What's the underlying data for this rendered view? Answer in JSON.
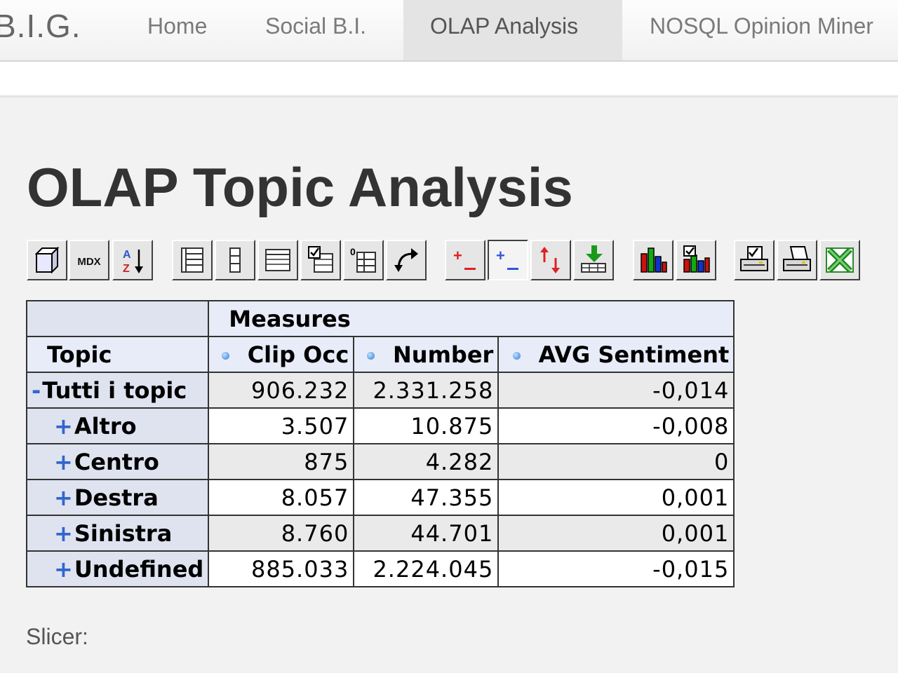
{
  "nav": {
    "brand": "B.I.G.",
    "items": [
      {
        "label": "Home",
        "active": false
      },
      {
        "label": "Social B.I.",
        "active": false
      },
      {
        "label": "OLAP Analysis",
        "active": true
      },
      {
        "label": "NOSQL Opinion Miner",
        "active": false
      }
    ]
  },
  "page": {
    "title": "OLAP Topic Analysis",
    "slicer_label": "Slicer:"
  },
  "toolbar": {
    "buttons": [
      {
        "icon": "cube-navigator-icon"
      },
      {
        "icon": "mdx-editor-icon",
        "text": "MDX"
      },
      {
        "icon": "sort-az-icon"
      },
      {
        "icon": "show-parents-icon"
      },
      {
        "icon": "hide-spans-icon"
      },
      {
        "icon": "show-properties-icon"
      },
      {
        "icon": "suppress-empty-icon"
      },
      {
        "icon": "swap-axes-icon",
        "text": "0"
      },
      {
        "icon": "rotate-axes-icon"
      },
      {
        "icon": "drill-member-icon"
      },
      {
        "icon": "drill-position-icon",
        "pressed": true
      },
      {
        "icon": "drill-replace-icon"
      },
      {
        "icon": "drill-through-icon"
      },
      {
        "icon": "show-chart-icon"
      },
      {
        "icon": "chart-config-icon"
      },
      {
        "icon": "print-config-icon"
      },
      {
        "icon": "print-pdf-icon"
      },
      {
        "icon": "excel-export-icon"
      }
    ]
  },
  "table": {
    "measures_header": "Measures",
    "dimension_header": "Topic",
    "columns": [
      "Clip Occ",
      "Number",
      "AVG Sentiment"
    ],
    "rows": [
      {
        "toggle": "-",
        "label": "Tutti i topic",
        "values": [
          "906.232",
          "2.331.258",
          "-0,014"
        ]
      },
      {
        "toggle": "+",
        "label": "Altro",
        "values": [
          "3.507",
          "10.875",
          "-0,008"
        ]
      },
      {
        "toggle": "+",
        "label": "Centro",
        "values": [
          "875",
          "4.282",
          "0"
        ]
      },
      {
        "toggle": "+",
        "label": "Destra",
        "values": [
          "8.057",
          "47.355",
          "0,001"
        ]
      },
      {
        "toggle": "+",
        "label": "Sinistra",
        "values": [
          "8.760",
          "44.701",
          "0,001"
        ]
      },
      {
        "toggle": "+",
        "label": "Undefined",
        "values": [
          "885.033",
          "2.224.045",
          "-0,015"
        ]
      }
    ]
  }
}
